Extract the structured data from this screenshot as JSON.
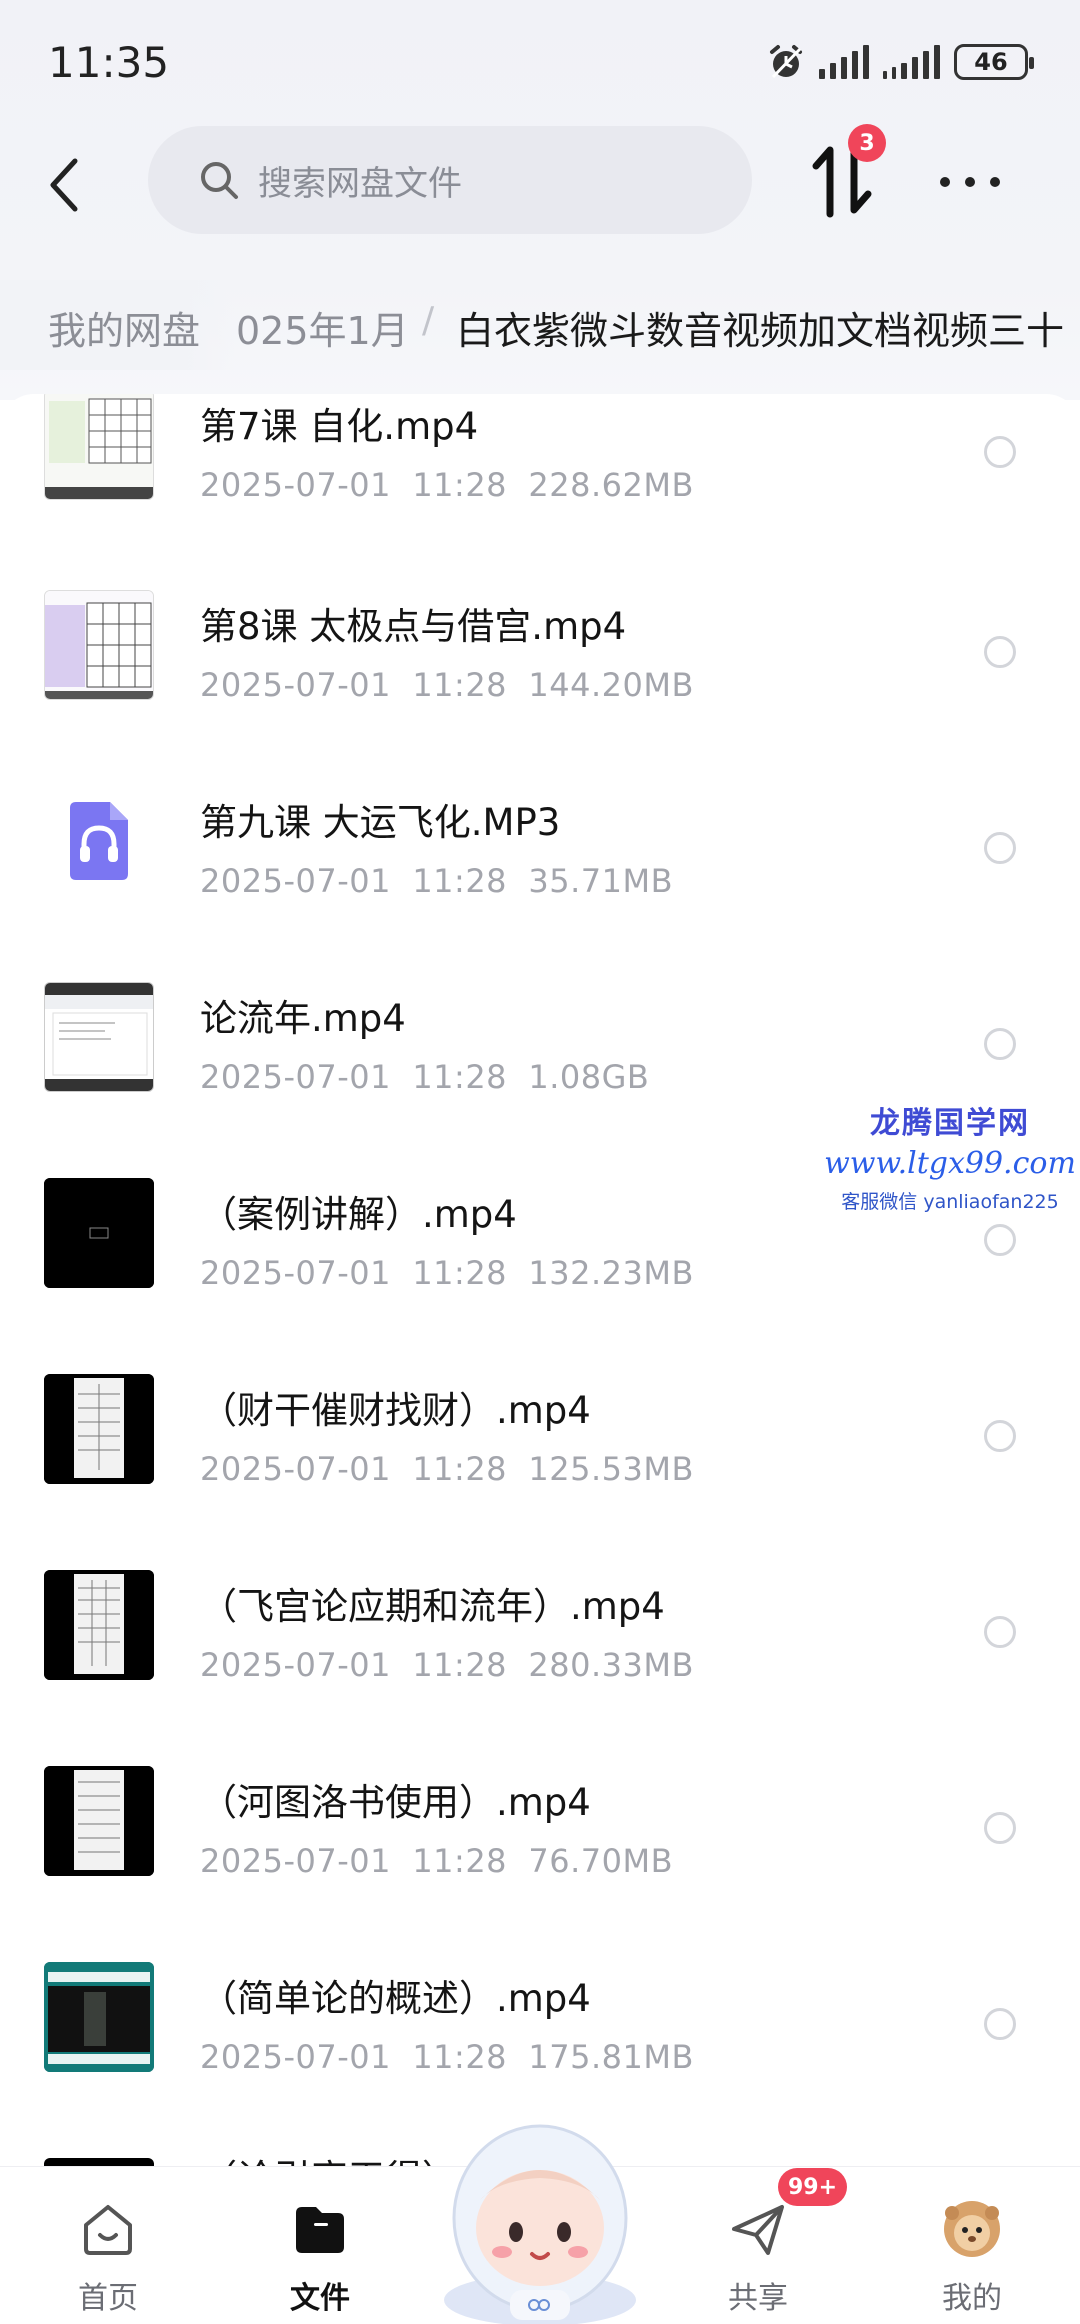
{
  "status_bar": {
    "time": "11:35",
    "battery": "46"
  },
  "header": {
    "search_placeholder": "搜索网盘文件",
    "transfer_badge": "3"
  },
  "breadcrumb": {
    "root": "我的网盘",
    "level1": "025年1月",
    "separator": "/",
    "current": "白衣紫微斗数音视频加文档视频三十"
  },
  "files": [
    {
      "name": "第7课 自化.mp4",
      "date": "2025-07-01",
      "time": "11:28",
      "size": "228.62MB",
      "thumb": "video-chart"
    },
    {
      "name": "第8课 太极点与借宫.mp4",
      "date": "2025-07-01",
      "time": "11:28",
      "size": "144.20MB",
      "thumb": "video-purple"
    },
    {
      "name": "第九课 大运飞化.MP3",
      "date": "2025-07-01",
      "time": "11:28",
      "size": "35.71MB",
      "thumb": "audio"
    },
    {
      "name": "论流年.mp4",
      "date": "2025-07-01",
      "time": "11:28",
      "size": "1.08GB",
      "thumb": "video-doc"
    },
    {
      "name": "（案例讲解）.mp4",
      "date": "2025-07-01",
      "time": "11:28",
      "size": "132.23MB",
      "thumb": "video-black"
    },
    {
      "name": "（财干催财找财）.mp4",
      "date": "2025-07-01",
      "time": "11:28",
      "size": "125.53MB",
      "thumb": "video-phone"
    },
    {
      "name": "（飞宫论应期和流年）.mp4",
      "date": "2025-07-01",
      "time": "11:28",
      "size": "280.33MB",
      "thumb": "video-phone"
    },
    {
      "name": "（河图洛书使用）.mp4",
      "date": "2025-07-01",
      "time": "11:28",
      "size": "76.70MB",
      "thumb": "video-phone"
    },
    {
      "name": "（简单论的概述）.mp4",
      "date": "2025-07-01",
      "time": "11:28",
      "size": "175.81MB",
      "thumb": "video-teal"
    },
    {
      "name": "（论引官天得）",
      "date": "",
      "time": "",
      "size": "",
      "thumb": "video-phone"
    }
  ],
  "watermark": {
    "line1": "龙腾国学网",
    "line2": "www.ltgx99.com",
    "line3": "客服微信 yanliaofan225"
  },
  "bottom_nav": {
    "home": "首页",
    "files": "文件",
    "share": "共享",
    "share_badge": "99+",
    "mine": "我的"
  },
  "colors": {
    "badge": "#f0455a",
    "accent": "#3f4bd4"
  }
}
